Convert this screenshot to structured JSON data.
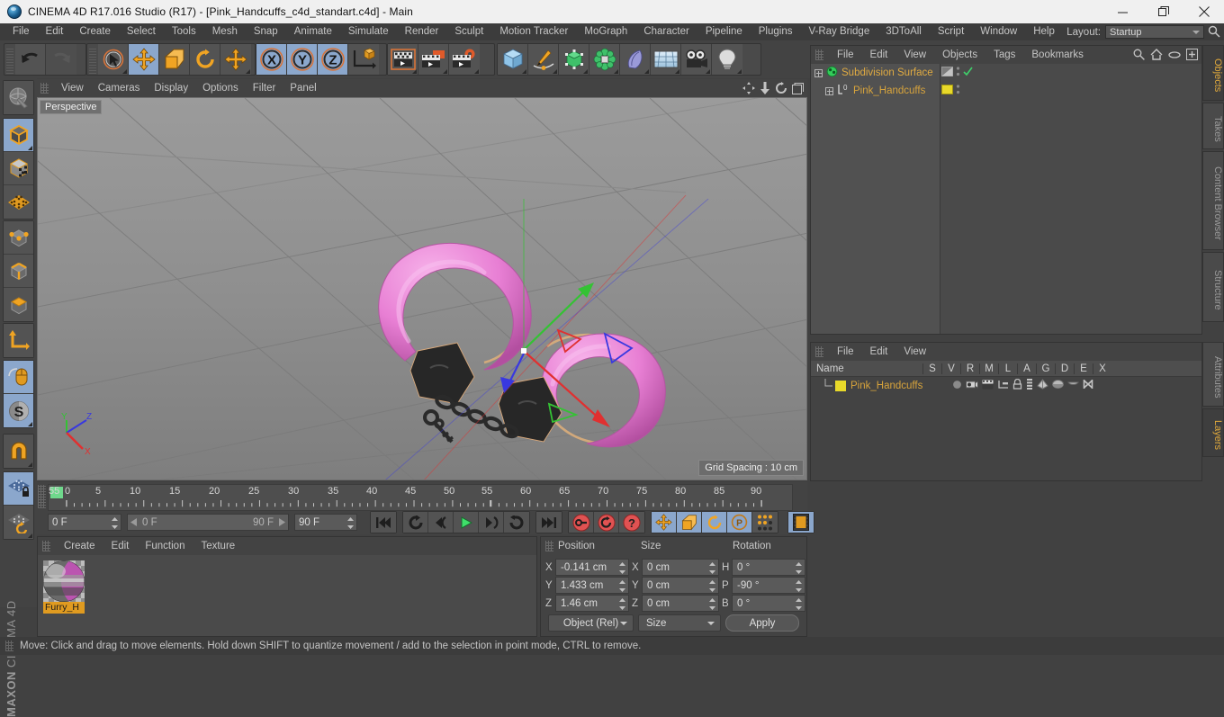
{
  "window": {
    "title": "CINEMA 4D R17.016 Studio (R17) - [Pink_Handcuffs_c4d_standart.c4d] - Main",
    "minimize": "—",
    "maximize": "❐",
    "close": "✕"
  },
  "menubar": {
    "items": [
      "File",
      "Edit",
      "Create",
      "Select",
      "Tools",
      "Mesh",
      "Snap",
      "Animate",
      "Simulate",
      "Render",
      "Sculpt",
      "Motion Tracker",
      "MoGraph",
      "Character",
      "Pipeline",
      "Plugins",
      "V-Ray Bridge",
      "3DToAll",
      "Script",
      "Window",
      "Help"
    ],
    "layout_label": "Layout:",
    "layout_value": "Startup"
  },
  "toolbar": {
    "undo": "undo-arrow",
    "redo": "redo-arrow",
    "live_select": "live-selection",
    "move": "move-tool",
    "scale": "scale-tool",
    "rotate": "rotate-tool",
    "move_duplicate": "move-tool-alt",
    "axis_x": "X",
    "axis_y": "Y",
    "axis_z": "Z",
    "world_axis": "world-coordinate-system",
    "render_view": "render-view",
    "render_region": "render-region",
    "render_settings": "render-settings",
    "add_cube": "add-cube-object",
    "add_spline": "add-spline",
    "add_generator": "add-generator",
    "add_deformer": "add-deformer",
    "add_scene": "add-scene-object",
    "add_environment": "add-environment",
    "add_camera": "add-camera",
    "add_light": "add-light"
  },
  "left_palette": {
    "items": [
      {
        "name": "make-editable",
        "selected": false
      },
      {
        "name": "model-mode",
        "selected": true
      },
      {
        "name": "texture-mode",
        "selected": false
      },
      {
        "name": "points-mode",
        "selected": false
      },
      {
        "name": "edges-mode",
        "selected": false
      },
      {
        "name": "polygons-mode",
        "selected": false
      },
      {
        "name": "axis-mode",
        "selected": false
      },
      {
        "name": "enable-axis-modification",
        "selected": false
      },
      {
        "name": "mouse-viewport-mode",
        "selected": true
      },
      {
        "name": "soft-selection",
        "selected": true
      },
      {
        "name": "enable-snapping",
        "selected": false
      },
      {
        "name": "lock-workplane",
        "selected": true
      },
      {
        "name": "workplane-rotate",
        "selected": false
      }
    ],
    "brand_line1": "MAXON",
    "brand_line2": "CINEMA 4D"
  },
  "viewport": {
    "menu": [
      "View",
      "Cameras",
      "Display",
      "Options",
      "Filter",
      "Panel"
    ],
    "badge": "Perspective",
    "grid_spacing": "Grid Spacing : 10 cm",
    "axis_labels": {
      "x": "X",
      "y": "Y",
      "z": "Z"
    }
  },
  "object_manager": {
    "menu": [
      "File",
      "Edit",
      "View",
      "Objects",
      "Tags",
      "Bookmarks"
    ],
    "icons": [
      "search-icon",
      "home-icon",
      "ellipse-icon",
      "add-layer-icon"
    ],
    "rows": [
      {
        "label": "Subdivision Surface",
        "icon": "subdivision-surface-icon",
        "selected": true,
        "indent": 0
      },
      {
        "label": "Pink_Handcuffs",
        "icon": "polygon-object-icon",
        "selected": false,
        "indent": 1
      }
    ]
  },
  "layer_manager": {
    "menu": [
      "File",
      "Edit",
      "View"
    ],
    "columns": [
      "Name",
      "S",
      "V",
      "R",
      "M",
      "L",
      "A",
      "G",
      "D",
      "E",
      "X"
    ],
    "rows": [
      {
        "name": "Pink_Handcuffs",
        "swatch": "#e8d92a"
      }
    ]
  },
  "side_tabs": {
    "top": [
      {
        "label": "Objects",
        "active": true
      },
      {
        "label": "Takes",
        "active": false
      },
      {
        "label": "Content Browser",
        "active": false
      },
      {
        "label": "Structure",
        "active": false
      }
    ],
    "bottom": [
      {
        "label": "Attributes",
        "active": false
      },
      {
        "label": "Layers",
        "active": true
      }
    ]
  },
  "timeline": {
    "tick_labels": [
      "0",
      "5",
      "10",
      "15",
      "20",
      "25",
      "30",
      "35",
      "40",
      "45",
      "50",
      "55",
      "60",
      "65",
      "70",
      "75",
      "80",
      "85",
      "90"
    ],
    "current_frame": "0 F",
    "range_start": "0 F",
    "range_end": "90 F",
    "end_frame": "90 F",
    "preview_frame": "0 F",
    "transport": [
      "go-to-start",
      "play-backwards-loop",
      "step-back",
      "play",
      "step-forward",
      "loop-playback",
      "go-to-end"
    ],
    "record_buttons": [
      "record-keyframe",
      "autokeying",
      "keyframe-selection"
    ],
    "key_toggles": [
      "position-key",
      "scale-key",
      "rotation-key",
      "parameter-key",
      "point-level-animation"
    ],
    "timeline_btn": "timeline-icon"
  },
  "material_manager": {
    "menu": [
      "Create",
      "Edit",
      "Function",
      "Texture"
    ],
    "materials": [
      {
        "label": "Furry_H",
        "name": "material-furry"
      }
    ]
  },
  "coordinates": {
    "headers": [
      "Position",
      "Size",
      "Rotation"
    ],
    "position": {
      "x": "-0.141 cm",
      "y": "1.433 cm",
      "z": "1.46 cm"
    },
    "size": {
      "x": "0 cm",
      "y": "0 cm",
      "z": "0 cm"
    },
    "rotation": {
      "h": "0 °",
      "p": "-90 °",
      "b": "0 °"
    },
    "axis_labels": {
      "px": "X",
      "py": "Y",
      "pz": "Z",
      "sx": "X",
      "sy": "Y",
      "sz": "Z",
      "rh": "H",
      "rp": "P",
      "rb": "B"
    },
    "mode_dropdown": "Object (Rel)",
    "size_dropdown": "Size",
    "apply_button": "Apply"
  },
  "statusbar": {
    "message": "Move: Click and drag to move elements. Hold down SHIFT to quantize movement / add to the selection in point mode, CTRL to remove."
  },
  "colors": {
    "accent_orange": "#e0a93c",
    "selection_blue": "#8ba7cc",
    "handcuff_pink": "#e87fd4",
    "axis_x": "#e03030",
    "axis_y": "#34c234",
    "axis_z": "#3838e0",
    "panel_bg": "#434343",
    "viewport_bg": "#8c8c8c"
  }
}
